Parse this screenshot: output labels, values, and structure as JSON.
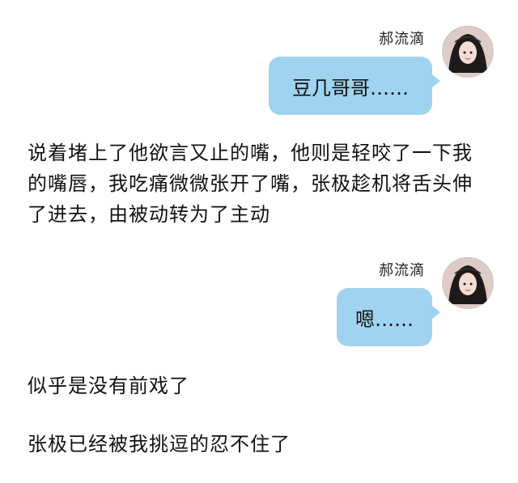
{
  "chat": {
    "messages": [
      {
        "sender": "郝流滴",
        "text": "豆几哥哥……"
      },
      {
        "sender": "郝流滴",
        "text": "嗯……"
      }
    ],
    "narration": [
      "说着堵上了他欲言又止的嘴，他则是轻咬了一下我的嘴唇，我吃痛微微张开了嘴，张极趁机将舌头伸了进去，由被动转为了主动",
      "似乎是没有前戏了",
      "张极已经被我挑逗的忍不住了"
    ]
  },
  "icons": {
    "avatar": "avatar-icon"
  },
  "colors": {
    "bubble": "#9fd3ef",
    "background": "#ffffff",
    "text": "#111111"
  }
}
